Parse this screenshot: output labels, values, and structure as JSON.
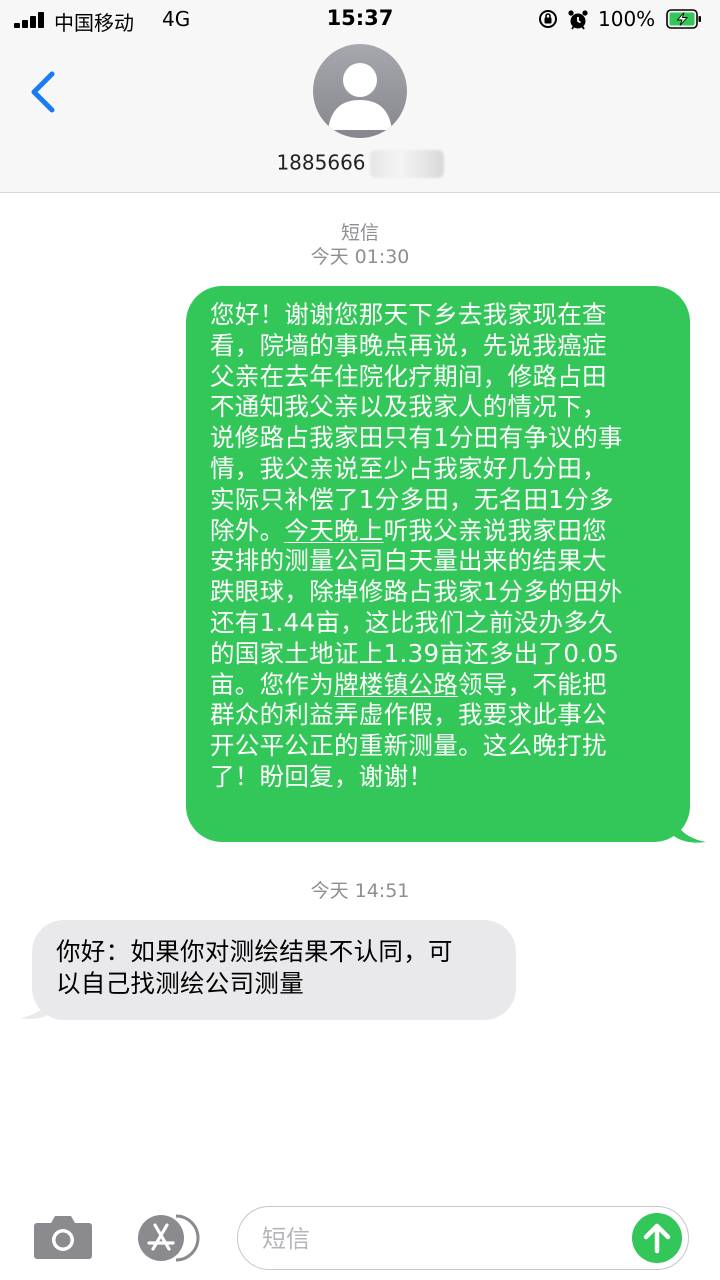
{
  "status_bar": {
    "carrier": "中国移动",
    "network": "4G",
    "time": "15:37",
    "battery": "100%"
  },
  "header": {
    "contact": "1885666",
    "back_icon": "chevron-left-icon",
    "avatar_icon": "person-icon"
  },
  "conversation": {
    "service_label": "短信",
    "first_timestamp": "今天 01:30",
    "outgoing_lines": [
      "您好！谢谢您那天下乡去我家现在查",
      "看，院墙的事晚点再说，先说我癌症",
      "父亲在去年住院化疗期间，修路占田",
      "不通知我父亲以及我家人的情况下，",
      "说修路占我家田只有1分田有争议的事",
      "情，我父亲说至少占我家好几分田，",
      "实际只补偿了1分多田，无名田1分多",
      "除外。今天晚上听我父亲说我家田您",
      "安排的测量公司白天量出来的结果大",
      "跌眼球，除掉修路占我家1分多的田外",
      "还有1.44亩，这比我们之前没办多久",
      "的国家土地证上1.39亩还多出了0.05",
      "亩。您作为牌楼镇公路领导，不能把",
      "群众的利益弄虚作假，我要求此事公",
      "开公平公正的重新测量。这么晚打扰",
      "了！盼回复，谢谢！"
    ],
    "second_timestamp": "今天 14:51",
    "incoming_lines": [
      "你好：如果你对测绘结果不认同，可",
      "以自己找测绘公司测量"
    ]
  },
  "composer": {
    "placeholder": "短信",
    "camera_icon": "camera-icon",
    "apps_icon": "app-store-icon",
    "send_icon": "arrow-up-icon"
  },
  "colors": {
    "sms_bubble": "#33c759",
    "incoming_bubble": "#e9e9eb",
    "accent": "#1a7cf5",
    "meta_text": "#8e8e93"
  }
}
